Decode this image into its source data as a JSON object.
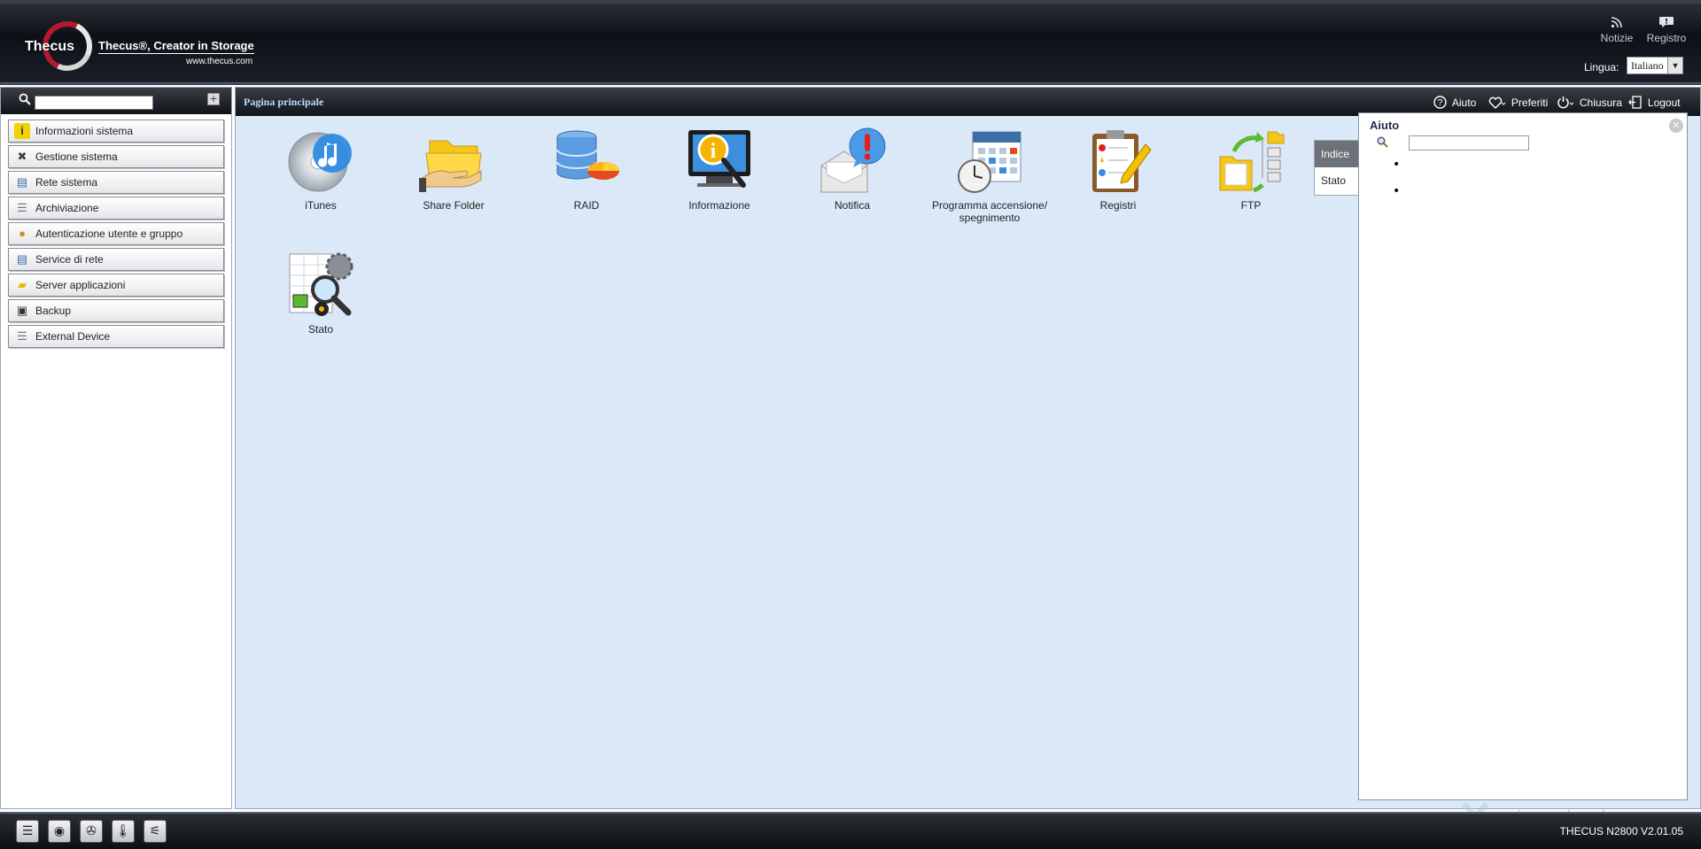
{
  "header": {
    "brand": "Thecus",
    "tagline": "Thecus®, Creator in Storage",
    "url": "www.thecus.com",
    "links": [
      {
        "label": "Notizie",
        "icon": "rss-icon"
      },
      {
        "label": "Registro",
        "icon": "chat-icon"
      }
    ],
    "language_label": "Lingua:",
    "language_value": "Italiano"
  },
  "sidebar": {
    "search_placeholder": "",
    "items": [
      {
        "label": "Informazioni sistema",
        "icon": "info-icon",
        "color": "#e6c200"
      },
      {
        "label": "Gestione sistema",
        "icon": "tools-icon",
        "color": "#555555"
      },
      {
        "label": "Rete sistema",
        "icon": "network-icon",
        "color": "#3a6ea5"
      },
      {
        "label": "Archiviazione",
        "icon": "storage-icon",
        "color": "#7a7a7a"
      },
      {
        "label": "Autenticazione utente e gruppo",
        "icon": "users-icon",
        "color": "#d98b2b"
      },
      {
        "label": "Service di rete",
        "icon": "network-service-icon",
        "color": "#3a6ea5"
      },
      {
        "label": "Server applicazioni",
        "icon": "folder-app-icon",
        "color": "#e6b800"
      },
      {
        "label": "Backup",
        "icon": "backup-icon",
        "color": "#b22222"
      },
      {
        "label": "External Device",
        "icon": "external-device-icon",
        "color": "#7a7a7a"
      }
    ]
  },
  "main": {
    "breadcrumb": "Pagina principale",
    "top_links": [
      {
        "label": "Aiuto",
        "icon": "help-icon"
      },
      {
        "label": "Preferiti",
        "icon": "heart-icon"
      },
      {
        "label": "Chiusura",
        "icon": "power-icon"
      },
      {
        "label": "Logout",
        "icon": "logout-icon"
      }
    ],
    "apps": [
      {
        "label": "iTunes",
        "icon": "itunes-icon"
      },
      {
        "label": "Share Folder",
        "icon": "share-folder-icon"
      },
      {
        "label": "RAID",
        "icon": "raid-icon"
      },
      {
        "label": "Informazione",
        "icon": "information-icon"
      },
      {
        "label": "Notifica",
        "icon": "notification-icon"
      },
      {
        "label": "Programma accensione/\nspegnimento",
        "icon": "schedule-icon"
      },
      {
        "label": "Registri",
        "icon": "logs-icon"
      },
      {
        "label": "FTP",
        "icon": "ftp-icon"
      },
      {
        "label": "Stato",
        "icon": "status-icon"
      }
    ],
    "side_tabs": [
      "Indice",
      "Stato"
    ]
  },
  "help": {
    "title": "Aiuto",
    "search_value": ""
  },
  "footer": {
    "version": "THECUS N2800 V2.01.05",
    "icons": [
      "disk-icon",
      "drive-icon",
      "fan-icon",
      "temperature-icon",
      "network-tree-icon"
    ]
  },
  "watermark": "xtremehardware.com"
}
